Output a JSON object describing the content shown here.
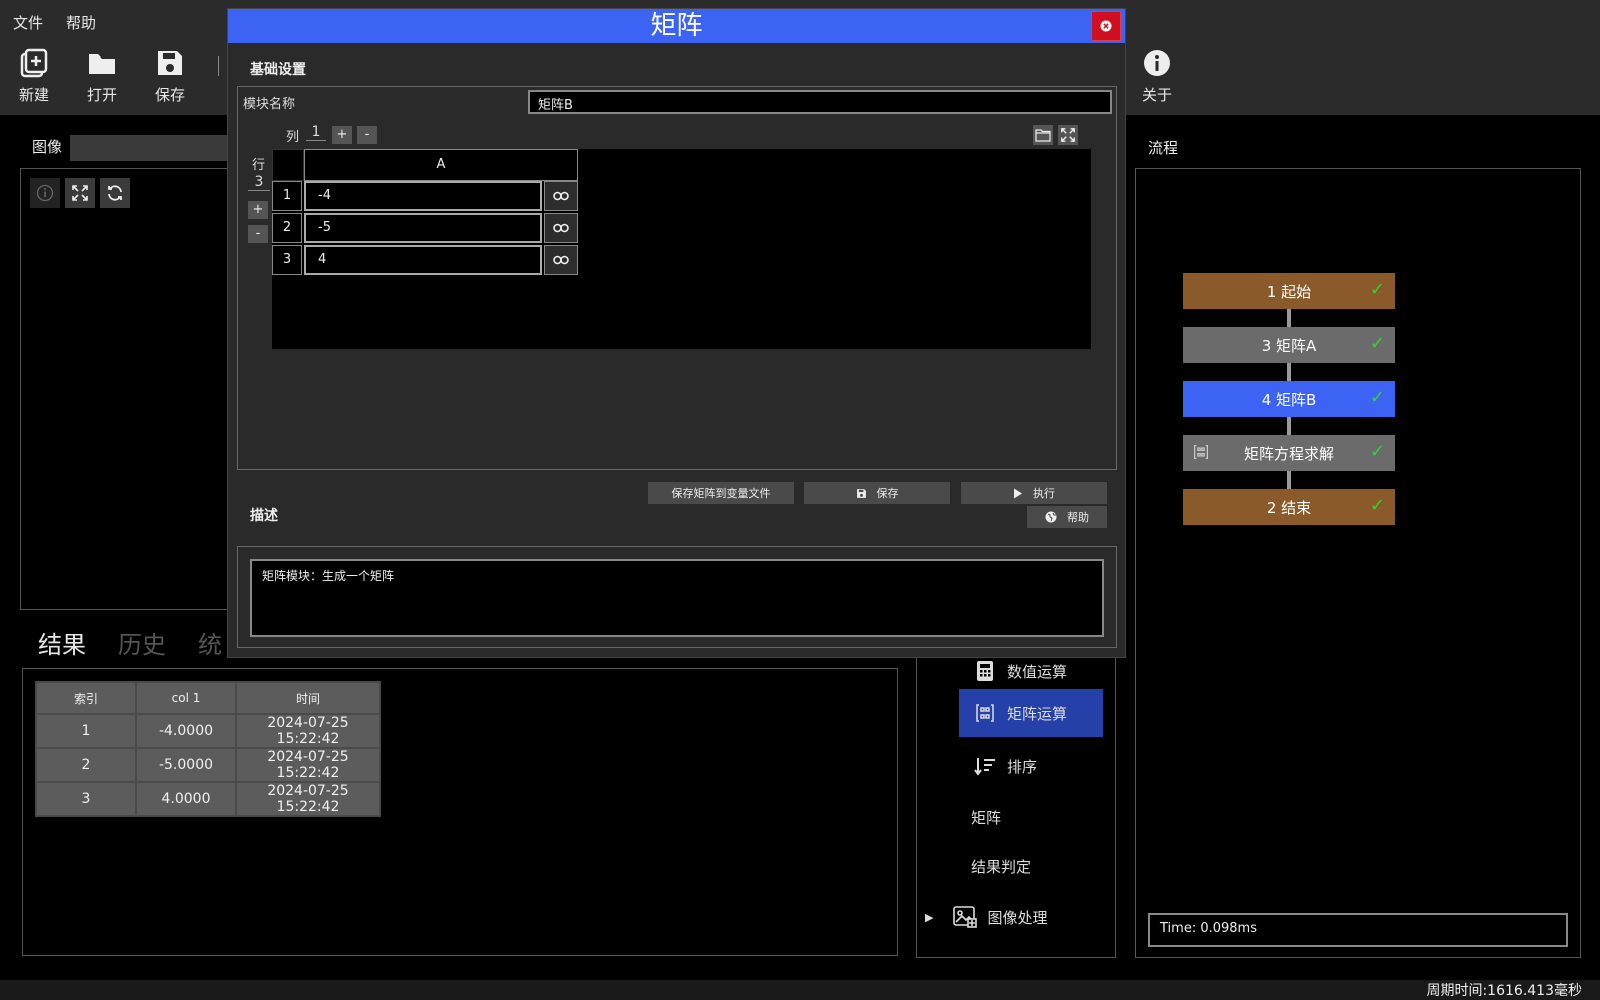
{
  "menu": {
    "file": "文件",
    "help": "帮助"
  },
  "toolbar": {
    "new": "新建",
    "open": "打开",
    "save": "保存",
    "about": "关于"
  },
  "image_panel": {
    "title": "图像"
  },
  "results": {
    "tabs": [
      "结果",
      "历史",
      "统"
    ],
    "columns": [
      "索引",
      "col 1",
      "时间"
    ],
    "rows": [
      [
        "1",
        "-4.0000",
        "2024-07-25 15:22:42"
      ],
      [
        "2",
        "-5.0000",
        "2024-07-25 15:22:42"
      ],
      [
        "3",
        "4.0000",
        "2024-07-25 15:22:42"
      ]
    ]
  },
  "modules": {
    "items": [
      {
        "label": "数值运算",
        "icon": "calculator-icon"
      },
      {
        "label": "矩阵运算",
        "icon": "matrix-icon",
        "active": true
      },
      {
        "label": "排序",
        "icon": "sort-icon"
      },
      {
        "label": "矩阵",
        "icon": ""
      },
      {
        "label": "结果判定",
        "icon": ""
      },
      {
        "label": "图像处理",
        "icon": "image-process-icon"
      }
    ]
  },
  "flow": {
    "title": "流程",
    "nodes": [
      {
        "label": "1 起始",
        "color": "#8a5a2b"
      },
      {
        "label": "3 矩阵A",
        "color": "#6b6b6b"
      },
      {
        "label": "4 矩阵B",
        "color": "#3d63f5"
      },
      {
        "label": "矩阵方程求解",
        "color": "#6b6b6b"
      },
      {
        "label": "2 结束",
        "color": "#8a5a2b"
      }
    ],
    "check": "✓",
    "time": "Time: 0.098ms"
  },
  "status": {
    "cycle_time": "周期时间:1616.413毫秒"
  },
  "dialog": {
    "title": "矩阵",
    "basic_title": "基础设置",
    "name_label": "模块名称",
    "name_value": "矩阵B",
    "col_label": "列",
    "col_count": "1",
    "row_label": "行",
    "row_count": "3",
    "plus": "+",
    "minus": "-",
    "column_headers": [
      "A"
    ],
    "rows": [
      {
        "index": "1",
        "value": "-4"
      },
      {
        "index": "2",
        "value": "-5"
      },
      {
        "index": "3",
        "value": "4"
      }
    ],
    "btn_save_to_var": "保存矩阵到变量文件",
    "btn_save": "保存",
    "btn_run": "执行",
    "desc_title": "描述",
    "btn_help": "帮助",
    "description": "矩阵模块：生成一个矩阵"
  },
  "colors": {
    "accent": "#3d63f5",
    "close": "#d01020",
    "active_module": "#2540a8",
    "check": "#32d232"
  }
}
